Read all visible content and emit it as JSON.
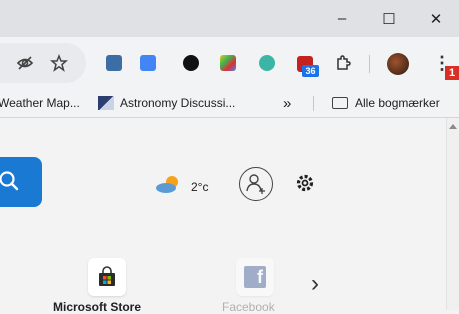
{
  "titlebar": {
    "minimize": "–",
    "maximize": "☐",
    "close": "✕"
  },
  "toolbar": {
    "menu_badge": "1",
    "calendar_badge": "36"
  },
  "bookmarks": {
    "item1": "Weather Map...",
    "item2": "Astronomy Discussi...",
    "overflow": "»",
    "all_bookmarks": "Alle bogmærker"
  },
  "page": {
    "temperature": "2°c",
    "tiles": [
      {
        "label": "Microsoft Store"
      },
      {
        "label": "Facebook"
      }
    ],
    "next": "›"
  },
  "colors": {
    "accent": "#1a79d3",
    "badge": "#d93025"
  }
}
